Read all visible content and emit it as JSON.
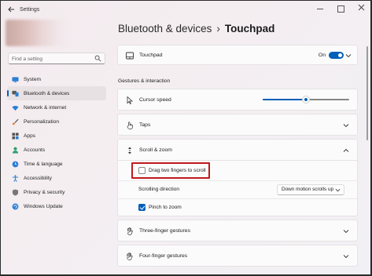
{
  "window": {
    "title": "Settings"
  },
  "search": {
    "placeholder": "Find a setting"
  },
  "sidebar": {
    "items": [
      {
        "label": "System",
        "icon": "monitor-icon"
      },
      {
        "label": "Bluetooth & devices",
        "icon": "bluetooth-devices-icon",
        "selected": true
      },
      {
        "label": "Network & internet",
        "icon": "wifi-icon"
      },
      {
        "label": "Personalization",
        "icon": "brush-icon"
      },
      {
        "label": "Apps",
        "icon": "apps-icon"
      },
      {
        "label": "Accounts",
        "icon": "person-icon"
      },
      {
        "label": "Time & language",
        "icon": "globe-clock-icon"
      },
      {
        "label": "Accessibility",
        "icon": "accessibility-icon"
      },
      {
        "label": "Privacy & security",
        "icon": "shield-icon"
      },
      {
        "label": "Windows Update",
        "icon": "update-icon"
      }
    ]
  },
  "breadcrumb": {
    "parent": "Bluetooth & devices",
    "separator": "›",
    "current": "Touchpad"
  },
  "touchpad": {
    "label": "Touchpad",
    "state_text": "On",
    "enabled": true
  },
  "gestures": {
    "heading": "Gestures & interaction",
    "cursor_speed_label": "Cursor speed",
    "cursor_speed_fraction": 0.5,
    "taps_label": "Taps",
    "scroll_zoom": {
      "label": "Scroll & zoom",
      "drag_two_fingers_label": "Drag two fingers to scroll",
      "drag_two_fingers_checked": false,
      "scrolling_direction_label": "Scrolling direction",
      "scrolling_direction_value": "Down motion scrolls up",
      "pinch_to_zoom_label": "Pinch to zoom",
      "pinch_to_zoom_checked": true
    },
    "three_finger_label": "Three-finger gestures",
    "four_finger_label": "Four-finger gestures"
  },
  "colors": {
    "accent": "#005fb8",
    "highlight": "#c0191c"
  }
}
